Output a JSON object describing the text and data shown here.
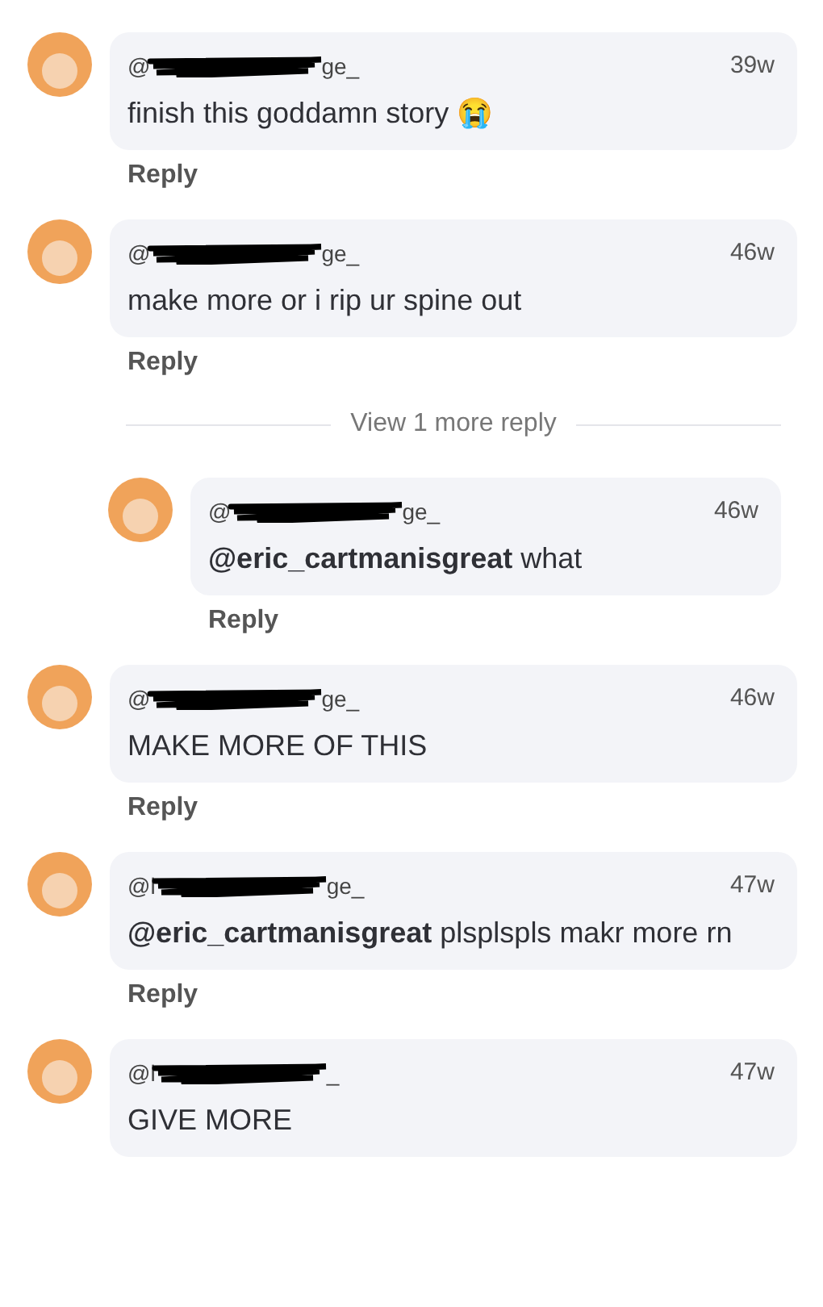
{
  "items": [
    {
      "kind": "comment",
      "user_start": "@",
      "user_end": "ge_",
      "time": "39w",
      "text": "finish this goddamn story",
      "emoji": "😭",
      "reply": "Reply"
    },
    {
      "kind": "comment",
      "user_start": "@",
      "user_end": "ge_",
      "time": "46w",
      "text": "make more or i rip ur spine out",
      "reply": "Reply"
    },
    {
      "kind": "more",
      "label": "View 1 more reply"
    },
    {
      "kind": "reply",
      "user_start": "@",
      "user_end": "ge_",
      "time": "46w",
      "text": "**@eric_cartmanisgreat** what",
      "reply": "Reply"
    },
    {
      "kind": "comment",
      "user_start": "@",
      "user_end": "ge_",
      "time": "46w",
      "text": "MAKE MORE OF THIS",
      "reply": "Reply"
    },
    {
      "kind": "comment",
      "user_start": "@l",
      "user_end": "ge_",
      "time": "47w",
      "text": "**@eric_cartmanisgreat** plsplspls makr more rn",
      "reply": "Reply"
    },
    {
      "kind": "comment",
      "user_start": "@l",
      "user_end": "_",
      "time": "47w",
      "text": "GIVE MORE"
    }
  ]
}
